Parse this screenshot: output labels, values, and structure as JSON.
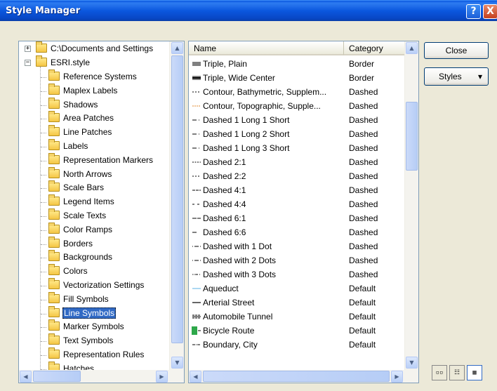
{
  "window": {
    "title": "Style Manager",
    "help_glyph": "?",
    "close_glyph": "X"
  },
  "tree": {
    "root": "C:\\Documents and Settings",
    "style_file": "ESRI.style",
    "items": [
      "Reference Systems",
      "Maplex Labels",
      "Shadows",
      "Area Patches",
      "Line Patches",
      "Labels",
      "Representation Markers",
      "North Arrows",
      "Scale Bars",
      "Legend Items",
      "Scale Texts",
      "Color Ramps",
      "Borders",
      "Backgrounds",
      "Colors",
      "Vectorization Settings",
      "Fill Symbols",
      "Line Symbols",
      "Marker Symbols",
      "Text Symbols",
      "Representation Rules",
      "Hatches"
    ],
    "selected": "Line Symbols"
  },
  "list": {
    "columns": {
      "name": "Name",
      "category": "Category"
    },
    "rows": [
      {
        "name": "Triple, Plain",
        "category": "Border",
        "symbol": "triple"
      },
      {
        "name": "Triple, Wide Center",
        "category": "Border",
        "symbol": "triple-wide"
      },
      {
        "name": "Contour, Bathymetric, Supplem...",
        "category": "Dashed",
        "symbol": "dashed-fine"
      },
      {
        "name": "Contour, Topographic, Supple...",
        "category": "Dashed",
        "symbol": "dashed-orange"
      },
      {
        "name": "Dashed 1 Long 1 Short",
        "category": "Dashed",
        "symbol": "long-short"
      },
      {
        "name": "Dashed 1 Long 2 Short",
        "category": "Dashed",
        "symbol": "long-short"
      },
      {
        "name": "Dashed 1 Long 3 Short",
        "category": "Dashed",
        "symbol": "long-short"
      },
      {
        "name": "Dashed 2:1",
        "category": "Dashed",
        "symbol": "dash-2-1"
      },
      {
        "name": "Dashed 2:2",
        "category": "Dashed",
        "symbol": "dash-2-2"
      },
      {
        "name": "Dashed 4:1",
        "category": "Dashed",
        "symbol": "dash-4-1"
      },
      {
        "name": "Dashed 4:4",
        "category": "Dashed",
        "symbol": "dash-4-4"
      },
      {
        "name": "Dashed 6:1",
        "category": "Dashed",
        "symbol": "dash-6-1"
      },
      {
        "name": "Dashed 6:6",
        "category": "Dashed",
        "symbol": "dash-6-6"
      },
      {
        "name": "Dashed with 1 Dot",
        "category": "Dashed",
        "symbol": "dash-dot"
      },
      {
        "name": "Dashed with 2 Dots",
        "category": "Dashed",
        "symbol": "dash-dot"
      },
      {
        "name": "Dashed with 3 Dots",
        "category": "Dashed",
        "symbol": "dash-dots"
      },
      {
        "name": "Aqueduct",
        "category": "Default",
        "symbol": "aqueduct"
      },
      {
        "name": "Arterial Street",
        "category": "Default",
        "symbol": "solid"
      },
      {
        "name": "Automobile Tunnel",
        "category": "Default",
        "symbol": "tunnel"
      },
      {
        "name": "Bicycle Route",
        "category": "Default",
        "symbol": "bicycle"
      },
      {
        "name": "Boundary, City",
        "category": "Default",
        "symbol": "boundary"
      }
    ]
  },
  "buttons": {
    "close": "Close",
    "styles": "Styles",
    "styles_arrow": "▾"
  },
  "view_buttons": [
    "large-icons",
    "list",
    "report"
  ],
  "colors": {
    "titlebar": "#0b57de",
    "selection": "#316ac5",
    "aqueduct": "#5ab0e6",
    "contour_orange": "#e08a2c",
    "bicycle_green": "#2ea84a"
  }
}
